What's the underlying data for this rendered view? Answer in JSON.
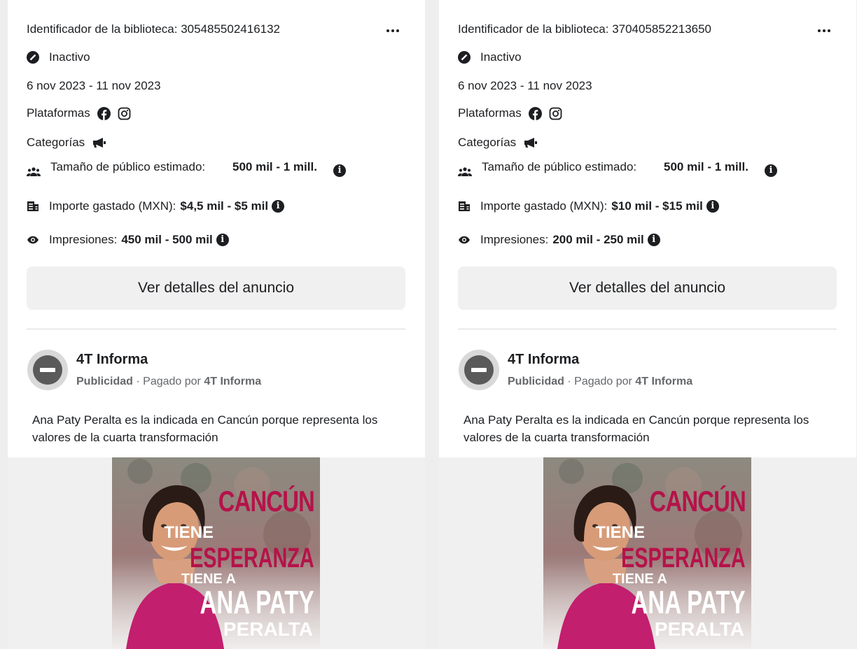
{
  "cards": [
    {
      "library_id_text": "Identificador de la biblioteca: 305485502416132",
      "status": "Inactivo",
      "date_range": "6 nov 2023 - 11 nov 2023",
      "platforms_label": "Plataformas",
      "platform_icons": [
        "facebook-icon",
        "instagram-icon"
      ],
      "categories_label": "Categorías",
      "category_icon": "megaphone-icon",
      "audience_label": "Tamaño de público estimado:",
      "audience_value": "500 mil - 1 mill.",
      "spent_label": "Importe gastado (MXN):",
      "spent_value": "$4,5 mil - $5 mil",
      "impressions_label": "Impresiones:",
      "impressions_value": "450 mil - 500 mil",
      "details_button": "Ver detalles del anuncio",
      "page_name": "4T Informa",
      "sponsored_label": "Publicidad",
      "paid_by_prefix": "Pagado por",
      "paid_by_name": "4T Informa",
      "ad_text": "Ana Paty Peralta es la indicada en Cancún porque representa los valores de la cuarta transformación",
      "creative": {
        "line1": "CANCÚN",
        "line2": "TIENE",
        "line3": "ESPERANZA",
        "line4": "TIENE A",
        "line5": "ANA PATY",
        "line6": "PERALTA"
      }
    },
    {
      "library_id_text": "Identificador de la biblioteca: 370405852213650",
      "status": "Inactivo",
      "date_range": "6 nov 2023 - 11 nov 2023",
      "platforms_label": "Plataformas",
      "platform_icons": [
        "facebook-icon",
        "instagram-icon"
      ],
      "categories_label": "Categorías",
      "category_icon": "megaphone-icon",
      "audience_label": "Tamaño de público estimado:",
      "audience_value": "500 mil - 1 mill.",
      "spent_label": "Importe gastado (MXN):",
      "spent_value": "$10 mil - $15 mil",
      "impressions_label": "Impresiones:",
      "impressions_value": "200 mil - 250 mil",
      "details_button": "Ver detalles del anuncio",
      "page_name": "4T Informa",
      "sponsored_label": "Publicidad",
      "paid_by_prefix": "Pagado por",
      "paid_by_name": "4T Informa",
      "ad_text": "Ana Paty Peralta es la indicada en Cancún porque representa los valores de la cuarta transformación",
      "creative": {
        "line1": "CANCÚN",
        "line2": "TIENE",
        "line3": "ESPERANZA",
        "line4": "TIENE A",
        "line5": "ANA PATY",
        "line6": "PERALTA"
      }
    }
  ]
}
